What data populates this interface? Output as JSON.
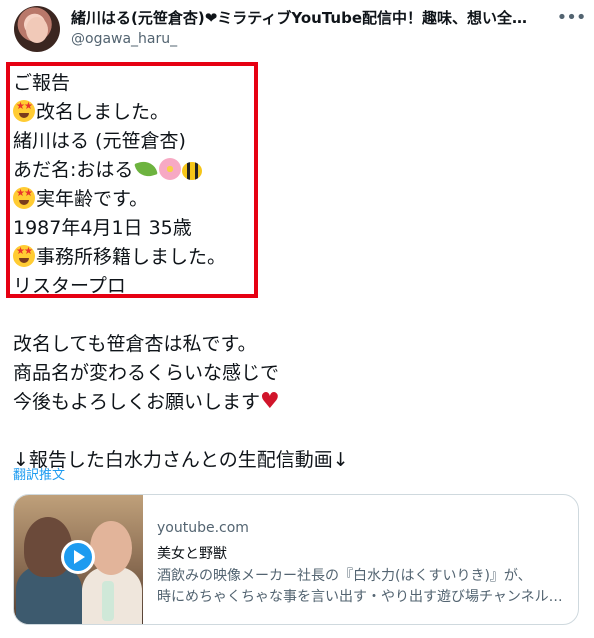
{
  "header": {
    "display_name": "緒川はる(元笹倉杏)❤ミラティブYouTube配信中！趣味、想い全部…",
    "handle": "@ogawa_haru_",
    "more_icon": "more-horizontal-icon"
  },
  "tweet": {
    "box_lines": [
      "ご報告",
      "改名しました。",
      "緒川はる (元笹倉杏)",
      "あだ名:おはる",
      "実年齢です。",
      "1987年4月1日 35歳",
      "事務所移籍しました。",
      "リスタープロ"
    ],
    "body_lines": [
      "改名しても笹倉杏は私です。",
      "商品名が変わるくらいな感じで",
      "今後もよろしくお願いします",
      "",
      "↓報告した白水力さんとの生配信動画↓"
    ],
    "emoji_names": [
      "star-struck-emoji",
      "leaf-emoji",
      "cherry-blossom-emoji",
      "bee-emoji",
      "red-heart-emoji"
    ],
    "highlight_color": "#e60012"
  },
  "translate_label": "翻訳推文",
  "card": {
    "domain": "youtube.com",
    "title": "美女と野獣",
    "description_lines": [
      "酒飲みの映像メーカー社長の『白水力(はくすいりき)』が、",
      "時にめちゃくちゃな事を言い出す・やり出す遊び場チャンネル…"
    ],
    "play_icon": "play-icon",
    "accent_color": "#1d9bf0"
  }
}
